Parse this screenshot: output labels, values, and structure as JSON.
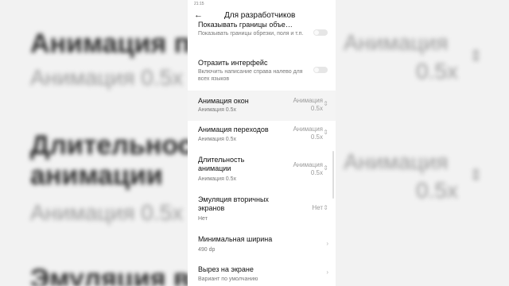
{
  "status_bar": {
    "time": "21:15"
  },
  "header": {
    "title": "Для разработчиков",
    "back_icon": "arrow-left-icon"
  },
  "items": [
    {
      "label": "Показывать границы объе…",
      "sub": "Показывать границы обрезки, поля и т.п.",
      "control": "toggle"
    },
    {
      "label": "Отразить интерфейс",
      "sub": "Включить написание справа налево для всех языков",
      "control": "toggle"
    },
    {
      "label": "Анимация окон",
      "sub": "Анимация 0.5x",
      "right": "Анимация 0.5x"
    },
    {
      "label": "Анимация переходов",
      "sub": "Анимация 0.5x",
      "right": "Анимация 0.5x"
    },
    {
      "label": "Длительность анимации",
      "sub": "Анимация 0.5x",
      "right": "Анимация 0.5x"
    },
    {
      "label": "Эмуляция вторичных экранов",
      "sub": "Нет",
      "right": "Нет"
    },
    {
      "label": "Минимальная ширина",
      "sub": "490 dp"
    },
    {
      "label": "Вырез на экране",
      "sub": "Вариант по умолчанию"
    }
  ],
  "background": {
    "left_1": "Анимация п",
    "left_2": "Анимация 0.5x",
    "left_3": "Длительнос",
    "left_4": "анимации",
    "left_5": "Анимация 0.5x",
    "left_6": "Эмуляция в",
    "right_1": "Анимация",
    "right_2": "0.5x",
    "right_3": "Анимация",
    "right_4": "0.5x"
  }
}
